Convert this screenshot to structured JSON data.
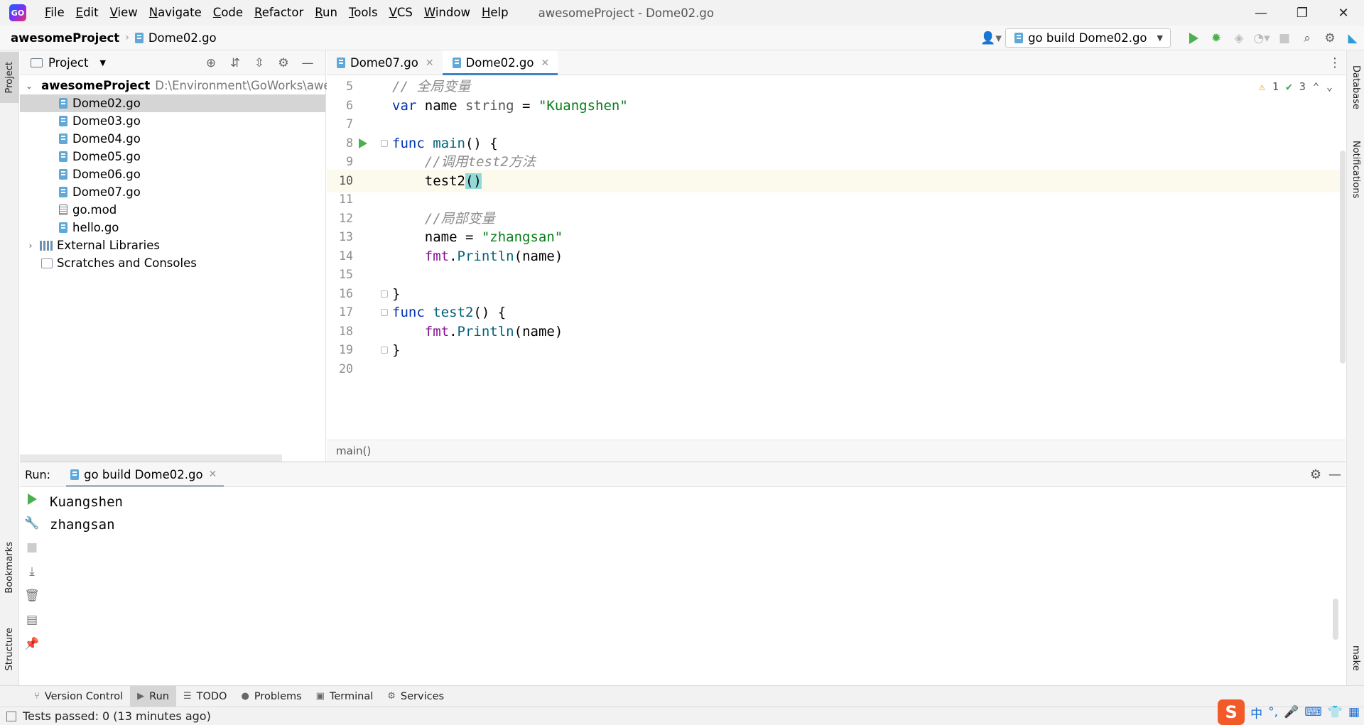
{
  "window": {
    "title": "awesomeProject - Dome02.go",
    "controls": {
      "minimize": "—",
      "restore": "❐",
      "close": "✕"
    }
  },
  "menu": [
    {
      "mn": "F",
      "rest": "ile"
    },
    {
      "mn": "E",
      "rest": "dit"
    },
    {
      "mn": "V",
      "rest": "iew"
    },
    {
      "mn": "N",
      "rest": "avigate"
    },
    {
      "mn": "C",
      "rest": "ode"
    },
    {
      "mn": "R",
      "rest": "efactor"
    },
    {
      "mn": "R",
      "rest": "un"
    },
    {
      "mn": "T",
      "rest": "ools"
    },
    {
      "mn": "V",
      "rest": "CS"
    },
    {
      "mn": "W",
      "rest": "indow"
    },
    {
      "mn": "H",
      "rest": "elp"
    }
  ],
  "navbar": {
    "project": "awesomeProject",
    "file": "Dome02.go",
    "run_config": "go build Dome02.go"
  },
  "left_strip": {
    "project": "Project",
    "bookmarks": "Bookmarks",
    "structure": "Structure"
  },
  "right_strip": {
    "database": "Database",
    "notifications": "Notifications",
    "make": "make"
  },
  "project_panel": {
    "title": "Project",
    "root": {
      "name": "awesomeProject",
      "path": "D:\\Environment\\GoWorks\\awesom"
    },
    "files": [
      "Dome02.go",
      "Dome03.go",
      "Dome04.go",
      "Dome05.go",
      "Dome06.go",
      "Dome07.go",
      "go.mod",
      "hello.go"
    ],
    "external_libraries": "External Libraries",
    "scratches": "Scratches and Consoles"
  },
  "editor": {
    "tabs": [
      "Dome07.go",
      "Dome02.go"
    ],
    "active_tab": "Dome02.go",
    "line_numbers": [
      "5",
      "6",
      "7",
      "8",
      "9",
      "10",
      "11",
      "12",
      "13",
      "14",
      "15",
      "16",
      "17",
      "18",
      "19",
      "20"
    ],
    "current_line": "10",
    "inspection": {
      "warnings": "1",
      "ok": "3"
    },
    "code": {
      "l5_comment": "// 全局变量",
      "l6_var": "var",
      "l6_name": " name ",
      "l6_type": "string",
      "l6_eq": " = ",
      "l6_str": "\"Kuangshen\"",
      "l8_func": "func",
      "l8_name": "main",
      "l8_rest": "() {",
      "l9_comment": "//调用test2方法",
      "l10_call": "test2",
      "l10_parens": "()",
      "l12_comment": "//局部变量",
      "l13_lhs": "name = ",
      "l13_str": "\"zhangsan\"",
      "l14_pkg": "fmt",
      "l14_dot": ".",
      "l14_fn": "Println",
      "l14_args": "(name)",
      "l16_brace": "}",
      "l17_func": "func",
      "l17_name": "test2",
      "l17_rest": "() {",
      "l18_pkg": "fmt",
      "l18_dot": ".",
      "l18_fn": "Println",
      "l18_args": "(name)",
      "l19_brace": "}"
    },
    "breadcrumb": "main()"
  },
  "run_panel": {
    "label": "Run:",
    "tab": "go build Dome02.go",
    "output": [
      "Kuangshen",
      "zhangsan"
    ]
  },
  "bottom_tools": [
    "Version Control",
    "Run",
    "TODO",
    "Problems",
    "Terminal",
    "Services"
  ],
  "bottom_active": "Run",
  "status": {
    "text": "Tests passed: 0 (13 minutes ago)"
  },
  "tray": {
    "ime_logo": "S",
    "ime_lang": "中"
  },
  "colors": {
    "accent": "#4083c9",
    "run_green": "#4caf50",
    "keyword": "#0033b3",
    "string": "#067d17",
    "comment": "#8c8c8c"
  }
}
